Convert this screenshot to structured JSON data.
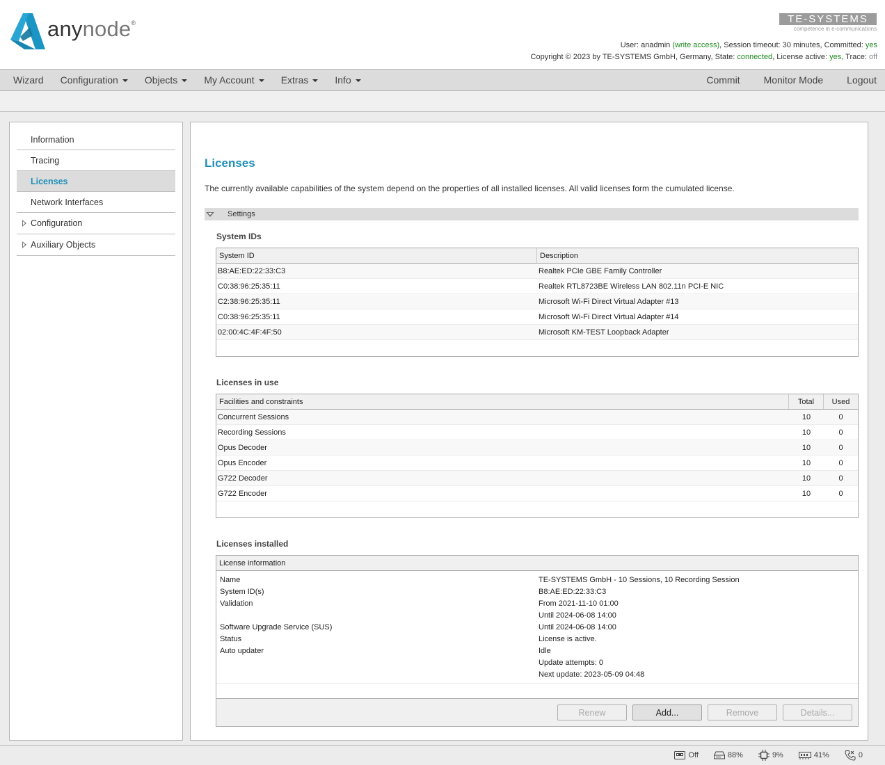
{
  "header": {
    "brand_bold": "any",
    "brand_light": "node",
    "brand_reg": "®",
    "vendor_logo": "TE-SYSTEMS",
    "vendor_tagline": "competence in e-communications",
    "status_line1": {
      "user_label": "User: anadmin ",
      "user_access": "(write access)",
      "session": ", Session timeout: 30 minutes, Committed: ",
      "committed": "yes"
    },
    "status_line2": {
      "copyright": "Copyright © 2023 by TE-SYSTEMS GmbH, Germany, State: ",
      "state": "connected",
      "license_label": ", License active: ",
      "license_active": "yes",
      "trace_label": ", Trace: ",
      "trace": "off"
    }
  },
  "menu": {
    "left": [
      {
        "label": "Wizard",
        "dropdown": false
      },
      {
        "label": "Configuration",
        "dropdown": true
      },
      {
        "label": "Objects",
        "dropdown": true
      },
      {
        "label": "My Account",
        "dropdown": true
      },
      {
        "label": "Extras",
        "dropdown": true
      },
      {
        "label": "Info",
        "dropdown": true
      }
    ],
    "right": [
      {
        "label": "Commit"
      },
      {
        "label": "Monitor Mode"
      },
      {
        "label": "Logout"
      }
    ]
  },
  "sidebar": {
    "items": [
      {
        "label": "Information",
        "active": false,
        "tree": false
      },
      {
        "label": "Tracing",
        "active": false,
        "tree": false
      },
      {
        "label": "Licenses",
        "active": true,
        "tree": false
      },
      {
        "label": "Network Interfaces",
        "active": false,
        "tree": false
      },
      {
        "label": "Configuration",
        "active": false,
        "tree": true
      },
      {
        "label": "Auxiliary Objects",
        "active": false,
        "tree": true
      }
    ]
  },
  "main": {
    "title": "Licenses",
    "description": "The currently available capabilities of the system depend on the properties of all installed licenses. All valid licenses form the cumulated license.",
    "settings_label": "Settings",
    "system_ids": {
      "title": "System IDs",
      "columns": [
        "System ID",
        "Description"
      ],
      "rows": [
        [
          "B8:AE:ED:22:33:C3",
          "Realtek PCIe GBE Family Controller"
        ],
        [
          "C0:38:96:25:35:11",
          "Realtek RTL8723BE Wireless LAN 802.11n PCI-E NIC"
        ],
        [
          "C2:38:96:25:35:11",
          "Microsoft Wi-Fi Direct Virtual Adapter #13"
        ],
        [
          "C0:38:96:25:35:11",
          "Microsoft Wi-Fi Direct Virtual Adapter #14"
        ],
        [
          "02:00:4C:4F:4F:50",
          "Microsoft KM-TEST Loopback Adapter"
        ]
      ]
    },
    "licenses_in_use": {
      "title": "Licenses in use",
      "columns": [
        "Facilities and constraints",
        "Total",
        "Used"
      ],
      "rows": [
        [
          "Concurrent Sessions",
          "10",
          "0"
        ],
        [
          "Recording Sessions",
          "10",
          "0"
        ],
        [
          "Opus Decoder",
          "10",
          "0"
        ],
        [
          "Opus Encoder",
          "10",
          "0"
        ],
        [
          "G722 Decoder",
          "10",
          "0"
        ],
        [
          "G722 Encoder",
          "10",
          "0"
        ]
      ]
    },
    "licenses_installed": {
      "title": "Licenses installed",
      "column": "License information",
      "lines": [
        [
          "Name",
          "TE-SYSTEMS GmbH - 10 Sessions, 10 Recording Session"
        ],
        [
          "System ID(s)",
          "B8:AE:ED:22:33:C3"
        ],
        [
          "Validation",
          "From 2021-11-10 01:00"
        ],
        [
          "",
          "Until 2024-06-08 14:00"
        ],
        [
          "Software Upgrade Service (SUS)",
          "Until 2024-06-08 14:00"
        ],
        [
          "Status",
          "License is active."
        ],
        [
          "Auto updater",
          "Idle"
        ],
        [
          "",
          "Update attempts: 0"
        ],
        [
          "",
          "Next update: 2023-05-09 04:48"
        ]
      ],
      "buttons": [
        {
          "label": "Renew",
          "enabled": false
        },
        {
          "label": "Add...",
          "enabled": true
        },
        {
          "label": "Remove",
          "enabled": false
        },
        {
          "label": "Details...",
          "enabled": false
        }
      ]
    }
  },
  "statusbar": {
    "recording": {
      "icon": "recorder-icon",
      "value": "Off"
    },
    "disk": {
      "icon": "disk-icon",
      "value": "88%"
    },
    "cpu": {
      "icon": "cpu-icon",
      "value": "9%"
    },
    "memory": {
      "icon": "memory-icon",
      "value": "41%"
    },
    "calls": {
      "icon": "phone-icon",
      "value": "0"
    }
  },
  "colors": {
    "accent": "#1f8fb8",
    "status_green": "#1f8a1f",
    "menu_bg": "#dcdcdc"
  }
}
